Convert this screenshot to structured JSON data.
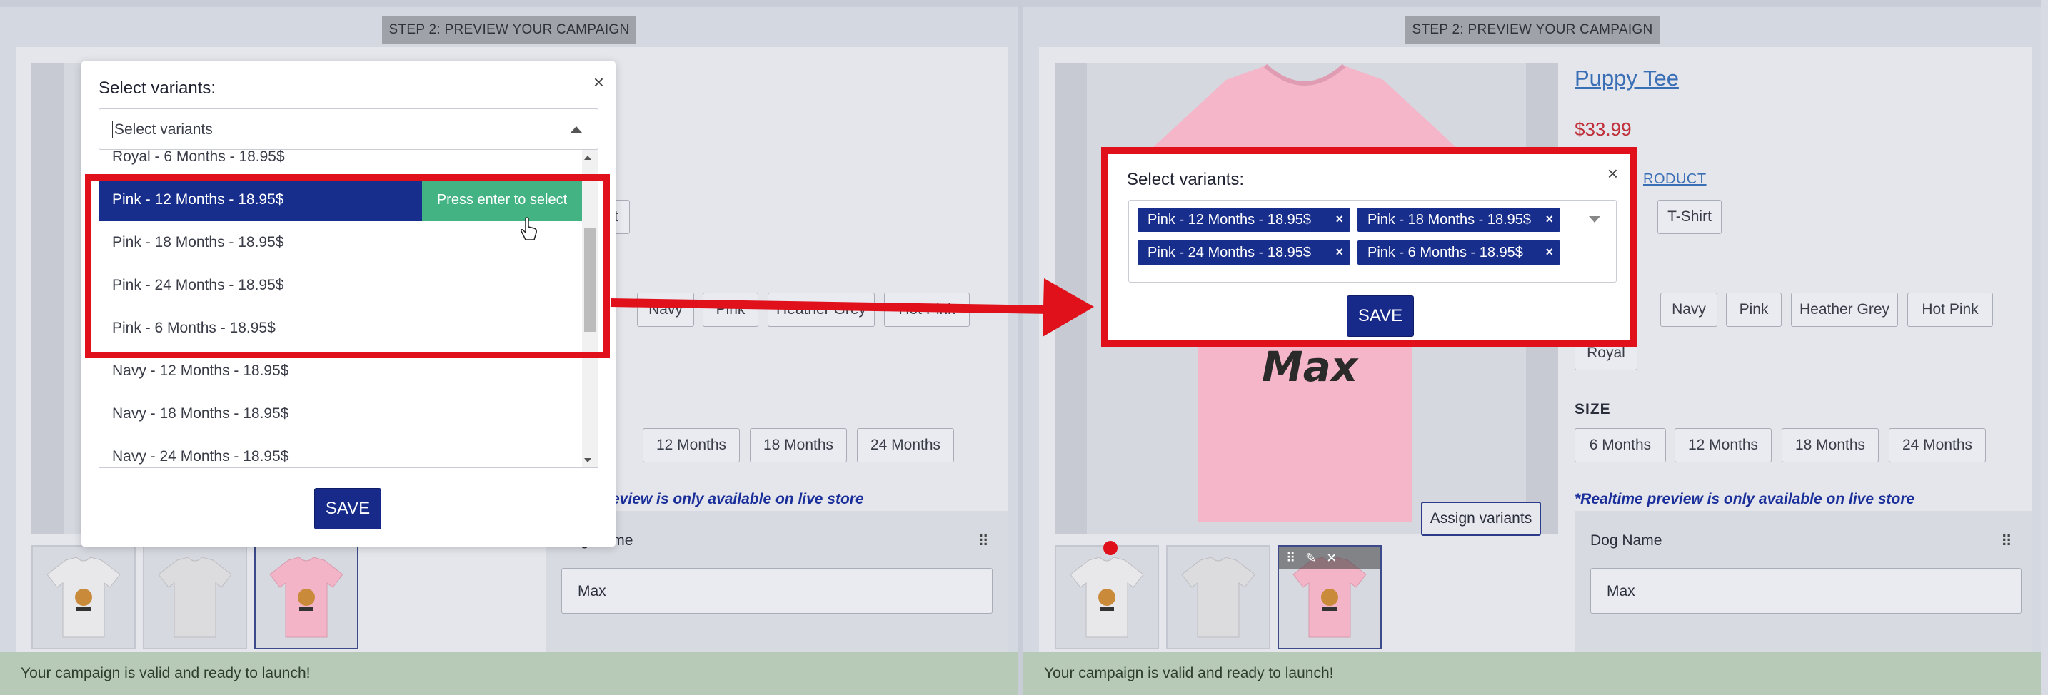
{
  "step_label": "STEP 2: PREVIEW YOUR CAMPAIGN",
  "product": {
    "title_partial": "ee",
    "title": "Puppy Tee",
    "price": "$33.99",
    "link_partial": "RODUCT",
    "style_partial_left": "y T-Shirt",
    "style_partial_right": "T-Shirt"
  },
  "colors": {
    "left_visible": [
      "Navy",
      "Pink",
      "Heather Grey",
      "Hot Pink"
    ],
    "right_visible": [
      "Navy",
      "Pink",
      "Heather Grey",
      "Hot Pink",
      "Royal"
    ]
  },
  "size": {
    "label": "SIZE",
    "left_visible": [
      "12 Months",
      "18 Months",
      "24 Months"
    ],
    "right_visible": [
      "6 Months",
      "12 Months",
      "18 Months",
      "24 Months"
    ]
  },
  "realtime_note_left": "eview is only available on live store",
  "realtime_note_right": "*Realtime preview is only available on live store",
  "dog_name": {
    "label": "Dog Name",
    "value": "Max",
    "handle": "⠿"
  },
  "assign_button": "Assign variants",
  "status": "Your campaign is valid and ready to launch!",
  "modal_left": {
    "title": "Select variants:",
    "close": "×",
    "placeholder": "Select variants",
    "options": [
      "Royal - 6 Months - 18.95$",
      "Pink - 12 Months - 18.95$",
      "Pink - 18 Months - 18.95$",
      "Pink - 24 Months - 18.95$",
      "Pink - 6 Months - 18.95$",
      "Navy - 12 Months - 18.95$",
      "Navy - 18 Months - 18.95$",
      "Navy - 24 Months - 18.95$"
    ],
    "highlighted_index": 1,
    "enter_hint": "Press enter to select",
    "save": "SAVE"
  },
  "modal_right": {
    "title": "Select variants:",
    "close": "×",
    "selected": [
      "Pink - 12 Months - 18.95$",
      "Pink - 18 Months - 18.95$",
      "Pink - 24 Months - 18.95$",
      "Pink - 6 Months - 18.95$"
    ],
    "remove": "×",
    "save": "SAVE"
  },
  "tee_print_text": "Max",
  "accent_colors": {
    "primary": "#182e8c",
    "enter_hint": "#44b383",
    "annotation": "#e1111b",
    "tee": "#f4b6c8"
  }
}
